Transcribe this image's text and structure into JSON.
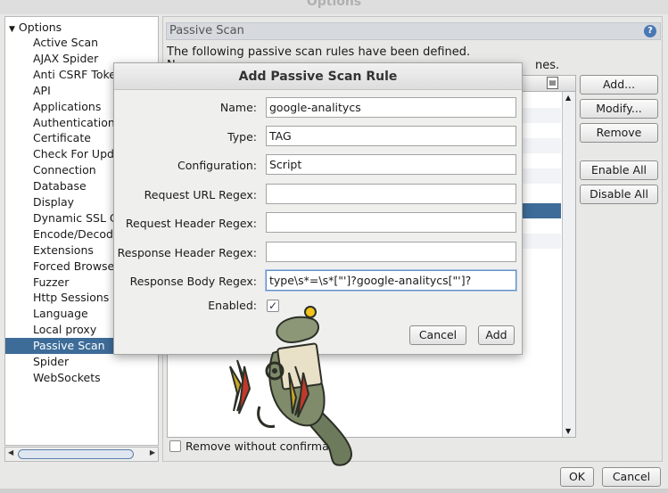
{
  "window": {
    "title": "Options"
  },
  "tree": {
    "root": "Options",
    "items": [
      "Active Scan",
      "AJAX Spider",
      "Anti CSRF Toke",
      "API",
      "Applications",
      "Authentication",
      "Certificate",
      "Check For Upd",
      "Connection",
      "Database",
      "Display",
      "Dynamic SSL C",
      "Encode/Decod",
      "Extensions",
      "Forced Browse",
      "Fuzzer",
      "Http Sessions",
      "Language",
      "Local proxy",
      "Passive Scan",
      "Spider",
      "WebSockets"
    ],
    "selected": "Passive Scan"
  },
  "panel": {
    "title": "Passive Scan",
    "description": "The following passive scan rules have been defined.",
    "description_partial_start": "N",
    "description_partial_end": "nes.",
    "buttons": {
      "add": "Add...",
      "modify": "Modify...",
      "remove": "Remove",
      "enable_all": "Enable All",
      "disable_all": "Disable All"
    },
    "remove_without_confirmation": "Remove without confirmation"
  },
  "dialog": {
    "title": "Add Passive Scan Rule",
    "fields": {
      "name": {
        "label": "Name:",
        "value": "google-analitycs"
      },
      "type": {
        "label": "Type:",
        "value": "TAG"
      },
      "configuration": {
        "label": "Configuration:",
        "value": "Script"
      },
      "request_url_regex": {
        "label": "Request URL Regex:",
        "value": ""
      },
      "request_header_regex": {
        "label": "Request Header Regex:",
        "value": ""
      },
      "response_header_regex": {
        "label": "Response Header Regex:",
        "value": ""
      },
      "response_body_regex": {
        "label": "Response Body Regex:",
        "value": "type\\s*=\\s*[\"']?google-analitycs[\"']?"
      },
      "enabled": {
        "label": "Enabled:",
        "checked": true
      }
    },
    "buttons": {
      "cancel": "Cancel",
      "add": "Add"
    }
  },
  "footer": {
    "ok": "OK",
    "cancel": "Cancel"
  },
  "icons": {
    "help": "help-icon",
    "column_chooser": "column-chooser-icon",
    "tree_expand": "triangle-down-icon",
    "mascot": "zap-lizard-mascot"
  }
}
